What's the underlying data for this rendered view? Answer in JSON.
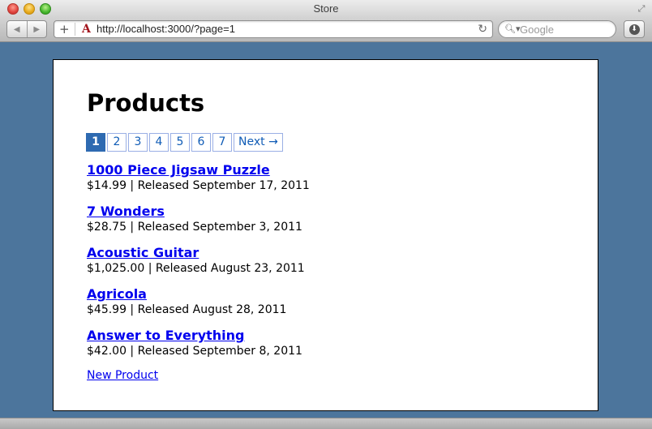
{
  "window": {
    "title": "Store"
  },
  "toolbar": {
    "url": "http://localhost:3000/?page=1",
    "search_placeholder": "Google"
  },
  "page": {
    "heading": "Products",
    "pagination": {
      "pages": [
        "1",
        "2",
        "3",
        "4",
        "5",
        "6",
        "7"
      ],
      "current": "1",
      "next_label": "Next →"
    },
    "products": [
      {
        "name": "1000 Piece Jigsaw Puzzle",
        "info": "$14.99 | Released September 17, 2011"
      },
      {
        "name": "7 Wonders",
        "info": "$28.75 | Released September 3, 2011"
      },
      {
        "name": "Acoustic Guitar",
        "info": "$1,025.00 | Released August 23, 2011"
      },
      {
        "name": "Agricola",
        "info": "$45.99 | Released August 28, 2011"
      },
      {
        "name": "Answer to Everything",
        "info": "$42.00 | Released September 8, 2011"
      }
    ],
    "new_product_label": "New Product"
  },
  "colors": {
    "page_background": "#4c759c",
    "current_page": "#2e6ab1",
    "link": "#0000ee"
  }
}
